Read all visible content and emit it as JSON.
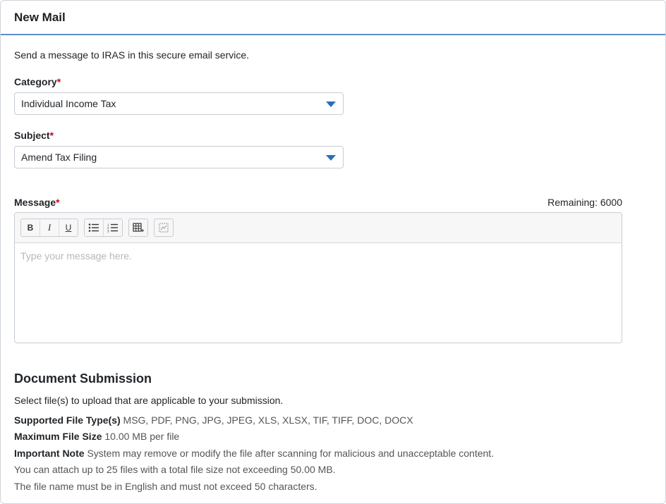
{
  "header": {
    "title": "New Mail"
  },
  "intro": "Send a message to IRAS in this secure email service.",
  "category": {
    "label": "Category",
    "required_mark": "*",
    "value": "Individual Income Tax"
  },
  "subject": {
    "label": "Subject",
    "required_mark": "*",
    "value": "Amend Tax Filing"
  },
  "message": {
    "label": "Message",
    "required_mark": "*",
    "remaining": "Remaining: 6000",
    "placeholder": "Type your message here.",
    "toolbar": {
      "bold": "B",
      "italic": "I",
      "underline": "U"
    }
  },
  "documents": {
    "title": "Document Submission",
    "select_text": "Select file(s) to upload that are applicable to your submission.",
    "supported_label": "Supported File Type(s)",
    "supported_value": "MSG, PDF, PNG, JPG, JPEG, XLS, XLSX, TIF, TIFF, DOC, DOCX",
    "max_label": "Maximum File Size",
    "max_value": "10.00 MB per file",
    "note_label": "Important Note",
    "note_value": "System may remove or modify the file after scanning for malicious and unacceptable content.",
    "attach_limit": "You can attach up to 25 files with a total file size not exceeding 50.00 MB.",
    "name_rule": "The file name must be in English and must not exceed 50 characters."
  }
}
